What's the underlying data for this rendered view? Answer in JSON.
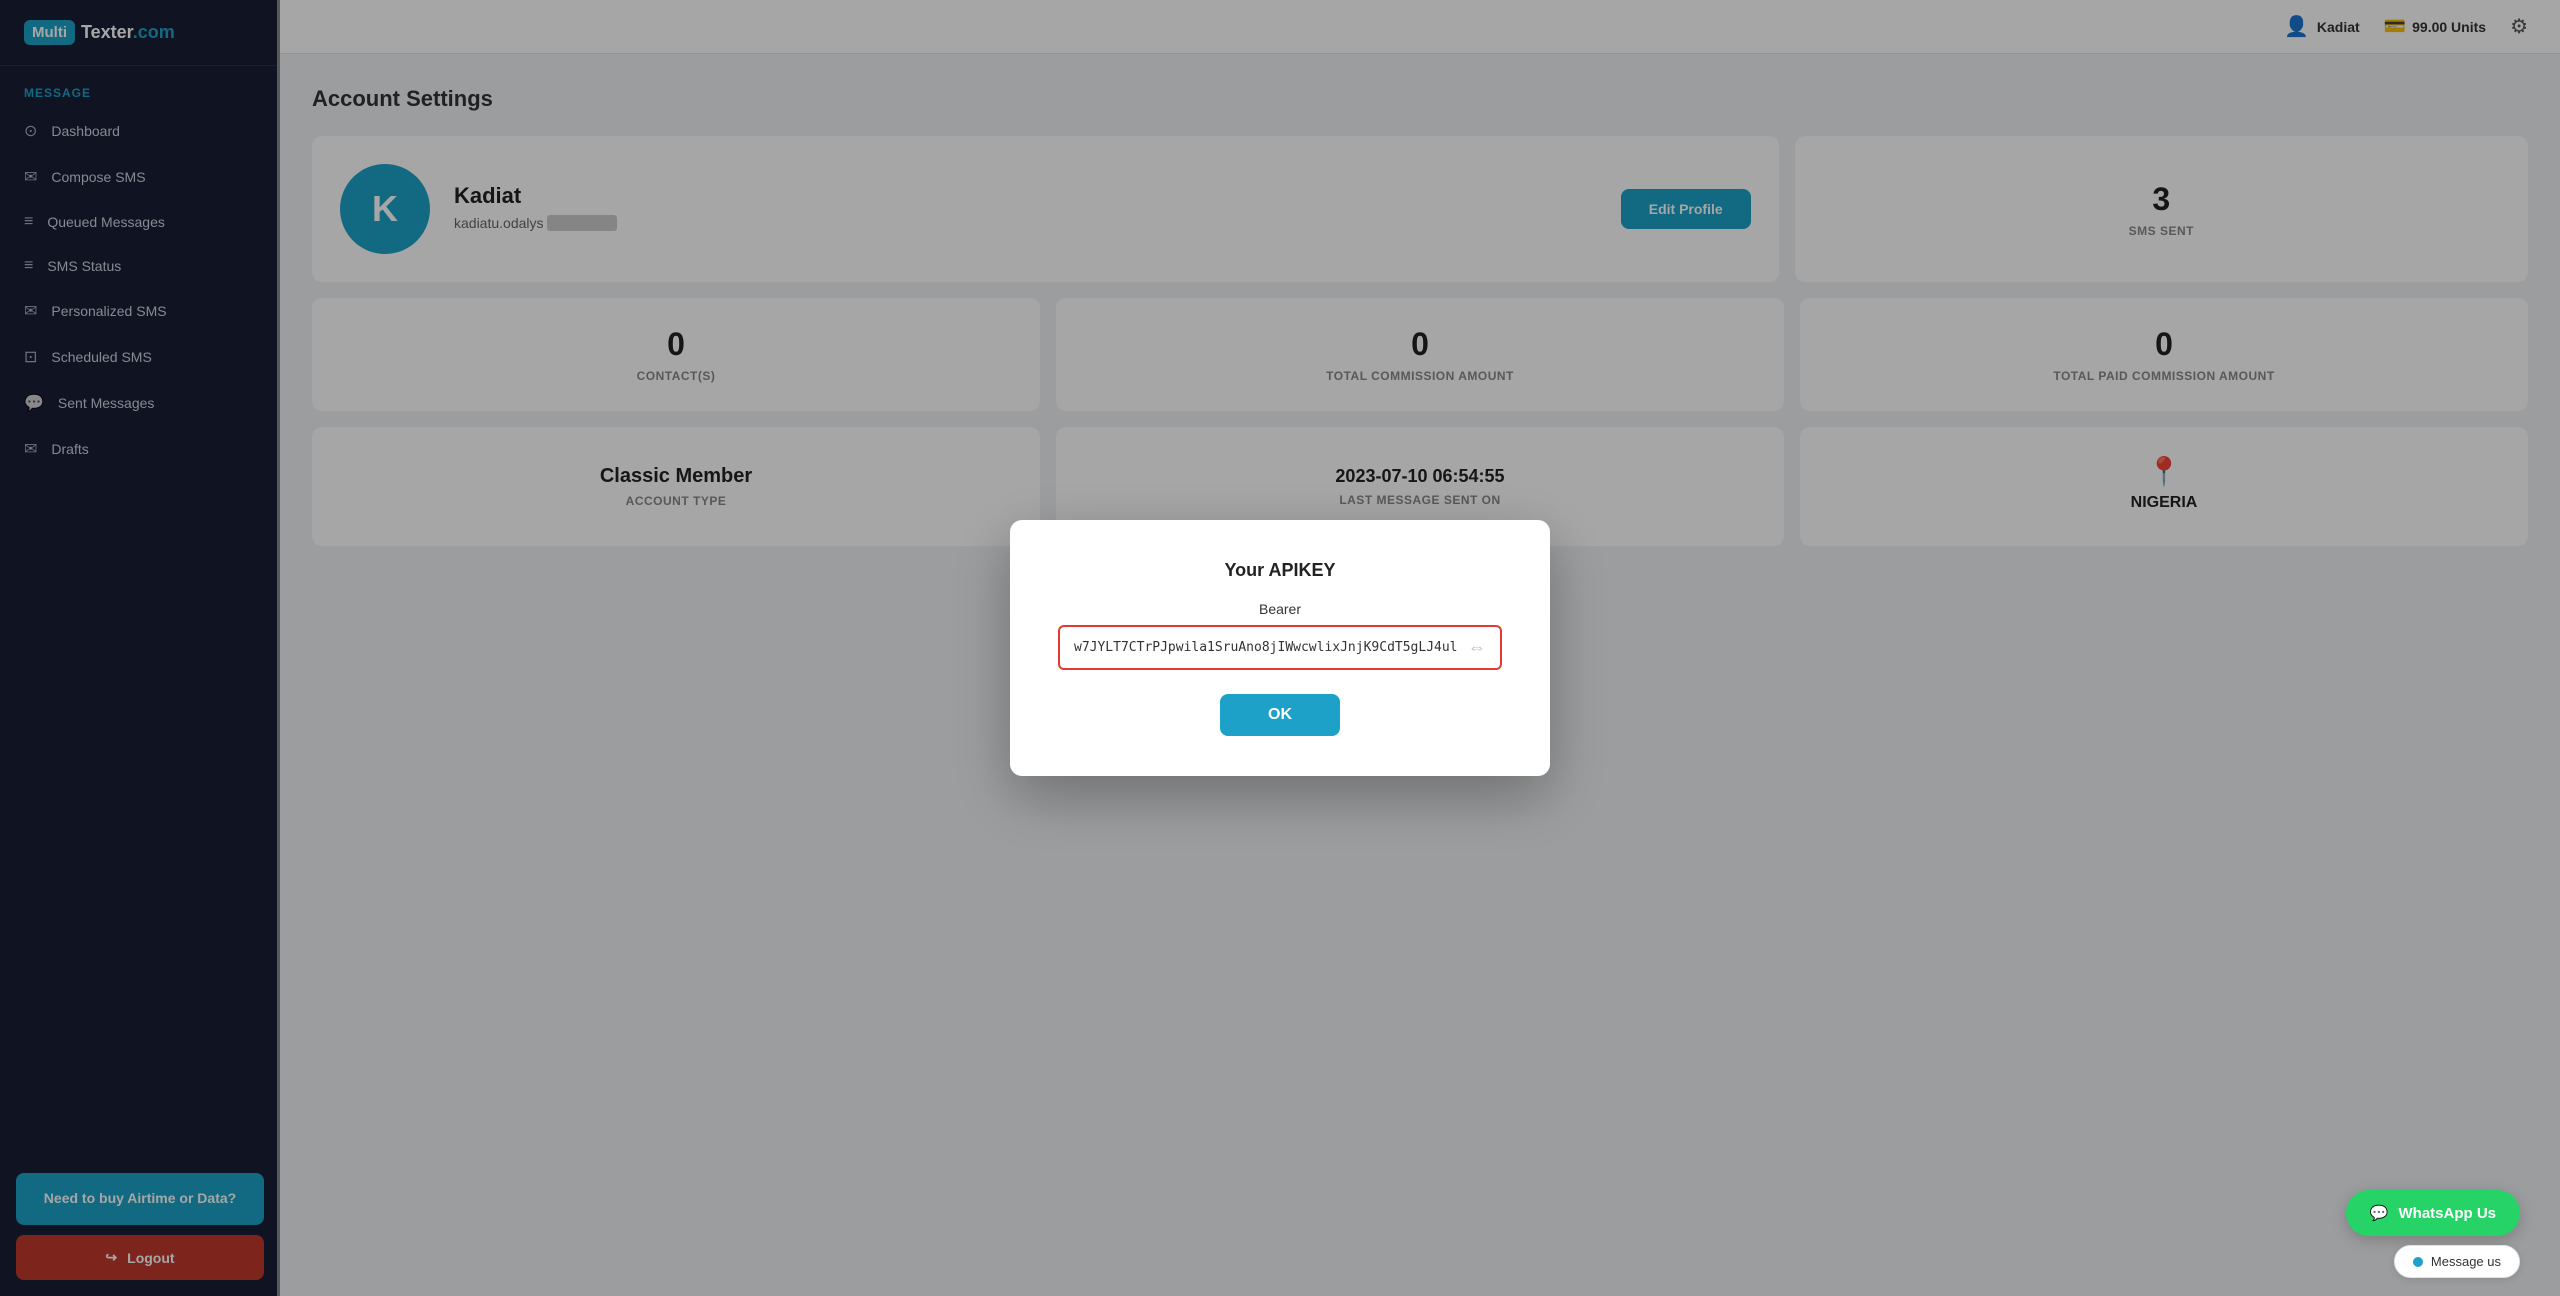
{
  "sidebar": {
    "logo": {
      "icon": "Multi",
      "text_plain": "Texter.com",
      "text_colored": "Multi"
    },
    "section_label": "Message",
    "items": [
      {
        "label": "Dashboard",
        "icon": "⊙"
      },
      {
        "label": "Compose SMS",
        "icon": "✉"
      },
      {
        "label": "Queued Messages",
        "icon": "≡"
      },
      {
        "label": "SMS Status",
        "icon": "≡"
      },
      {
        "label": "Personalized SMS",
        "icon": "✉"
      },
      {
        "label": "Scheduled SMS",
        "icon": "⊡"
      },
      {
        "label": "Sent Messages",
        "icon": "💬"
      },
      {
        "label": "Drafts",
        "icon": "✉"
      }
    ],
    "buy_airtime_label": "Need to buy Airtime or\nData?",
    "logout_label": "Logout"
  },
  "topbar": {
    "username": "Kadiat",
    "units": "99.00 Units"
  },
  "page": {
    "title": "Account Settings"
  },
  "profile": {
    "avatar_letter": "K",
    "name": "Kadiat",
    "email": "kadiatu.odalys",
    "email_blurred": "●●●●●●●●●●",
    "edit_button": "Edit Profile"
  },
  "stats": {
    "sms_sent_count": "3",
    "sms_sent_label": "SMS SENT",
    "contacts_count": "0",
    "contacts_label": "CONTACT(S)",
    "commission_count": "0",
    "commission_label": "TOTAL COMMISSION AMOUNT",
    "paid_commission_count": "0",
    "paid_commission_label": "TOTAL PAID COMMISSION AMOUNT",
    "account_type": "Classic Member",
    "account_type_label": "ACCOUNT TYPE",
    "last_message": "2023-07-10 06:54:55",
    "last_message_label": "LAST MESSAGE SENT ON",
    "country": "NIGERIA",
    "country_label": ""
  },
  "modal": {
    "title": "Your APIKEY",
    "bearer_label": "Bearer",
    "apikey": "w7JYLT7CTrPJpwila1SruAno8jIWwcwlixJnjK9CdT5gLJ4ul",
    "ok_button": "OK"
  },
  "whatsapp": {
    "button_label": "WhatsApp Us",
    "message_us_label": "Message us"
  }
}
